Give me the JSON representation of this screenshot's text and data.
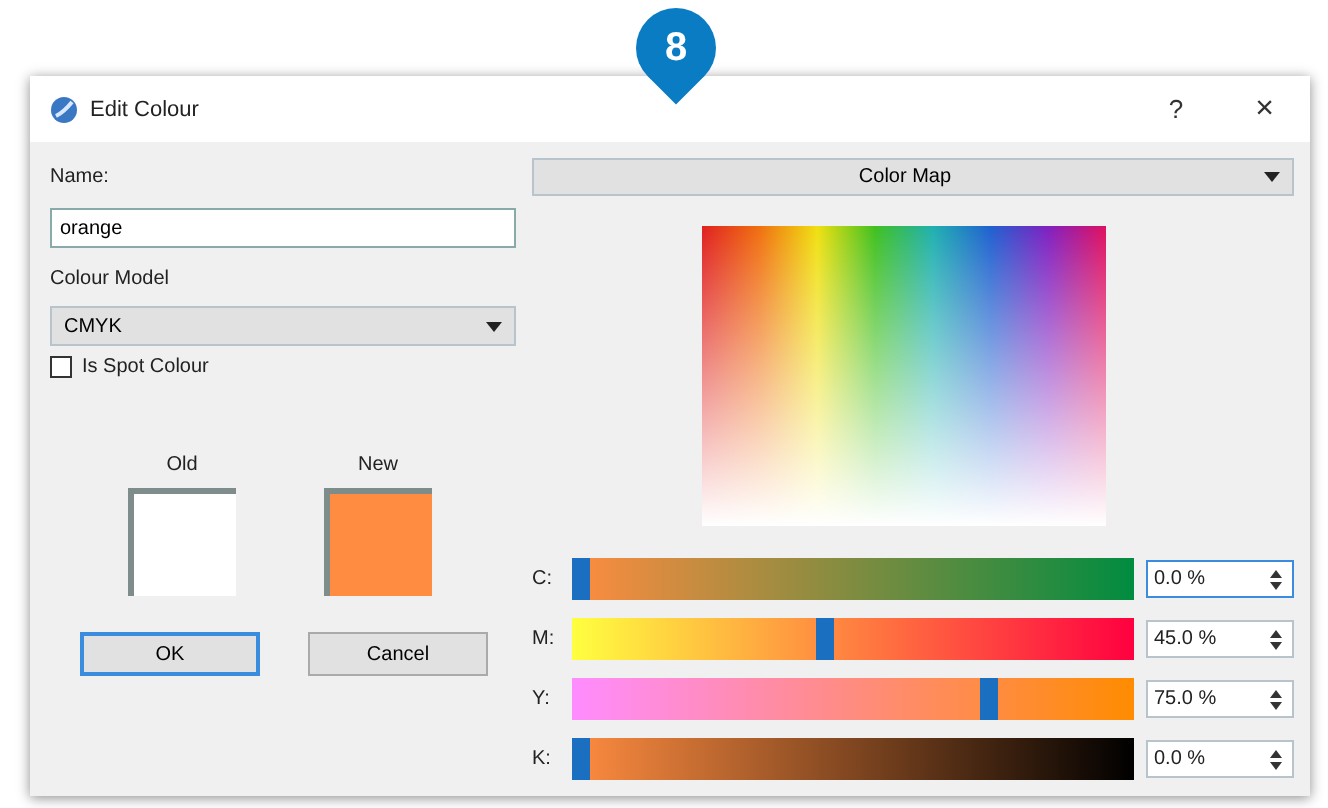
{
  "badge": "8",
  "window": {
    "title": "Edit Colour",
    "help": "?",
    "close": "×"
  },
  "name": {
    "label": "Name:",
    "value": "orange"
  },
  "colour_model": {
    "label": "Colour Model",
    "value": "CMYK"
  },
  "spot_colour": {
    "label": "Is Spot Colour",
    "checked": false
  },
  "old": {
    "label": "Old"
  },
  "new": {
    "label": "New"
  },
  "buttons": [
    "OK",
    "Cancel"
  ],
  "map_selector": {
    "value": "Color Map"
  },
  "channels": [
    {
      "label": "C:",
      "level": 0.0,
      "reading": "0.0 %"
    },
    {
      "label": "M:",
      "level": 0.45,
      "reading": "45.0 %"
    },
    {
      "label": "Y:",
      "level": 0.75,
      "reading": "75.0 %"
    },
    {
      "label": "K:",
      "level": 0.0,
      "reading": "0.0 %"
    }
  ]
}
